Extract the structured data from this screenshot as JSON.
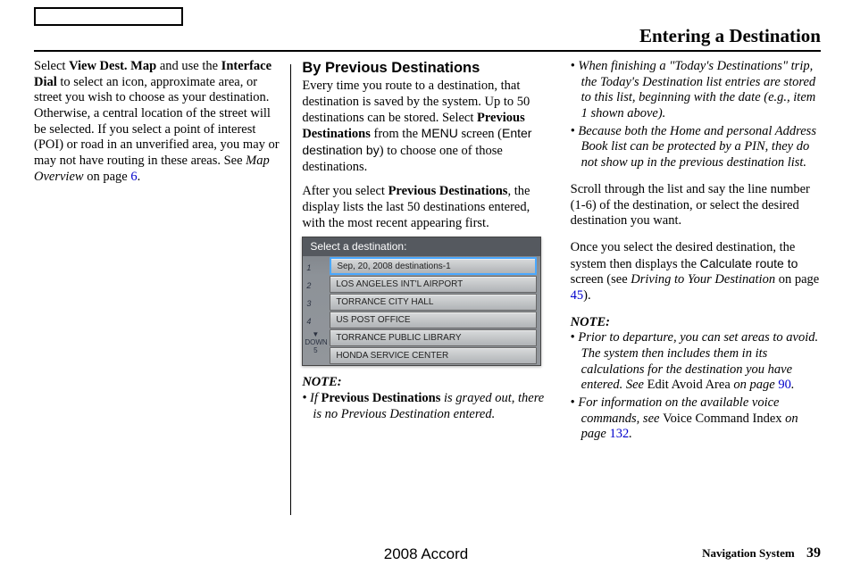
{
  "header": {
    "page_title": "Entering a Destination"
  },
  "col1": {
    "p1_a": "Select ",
    "p1_b": "View Dest. Map",
    "p1_c": " and use the ",
    "p1_d": "Interface Dial",
    "p1_e": " to select an icon, approximate area, or street you wish to choose as your destination. Otherwise, a central location of the street will be selected. If you select a point of interest (POI) or road in an unverified area, you may or may not have routing in these areas. See ",
    "p1_f": "Map Overview",
    "p1_g": " on page ",
    "p1_h": "6",
    "p1_i": "."
  },
  "col2": {
    "head": "By Previous Destinations",
    "p1_a": "Every time you route to a destination, that destination is saved by the system. Up to 50 destinations can be stored. Select ",
    "p1_b": "Previous Destinations",
    "p1_c": " from the ",
    "p1_d": "MENU",
    "p1_e": " screen (",
    "p1_f": "Enter destination by",
    "p1_g": ") to choose one of those destinations.",
    "p2_a": "After you select ",
    "p2_b": "Previous Destinations",
    "p2_c": ", the display lists the last 50 destinations entered, with the most recent appearing first.",
    "sc_header": "Select a destination:",
    "sc_items": {
      "r1": "Sep, 20, 2008 destinations-1",
      "r2": "LOS ANGELES INT'L AIRPORT",
      "r3": "TORRANCE CITY HALL",
      "r4": "US POST OFFICE",
      "r5": "TORRANCE PUBLIC LIBRARY",
      "r6": "HONDA SERVICE CENTER"
    },
    "note": "NOTE:",
    "note_li_a": "If ",
    "note_li_b": "Previous Destinations",
    "note_li_c": " is grayed out, there is no Previous Destination entered."
  },
  "col3": {
    "li1": "When finishing a \"Today's Destinations\" trip, the Today's Destination list entries are stored to this list, beginning with the date (e.g., item 1 shown above).",
    "li2": "Because both the Home and personal Address Book list can be protected by a PIN, they do not show up in the previous destination list.",
    "p1": "Scroll through the list and say the line number (1-6) of the destination, or select the desired destination you want.",
    "p2_a": "Once you select the desired destination, the system then displays the ",
    "p2_b": "Calculate route to",
    "p2_c": " screen (see ",
    "p2_d": "Driving to Your Destination",
    "p2_e": " on page ",
    "p2_f": "45",
    "p2_g": ").",
    "note": "NOTE:",
    "n1_a": "Prior to departure, you can set areas to avoid. The system then includes them in its calculations for the destination you have entered. See ",
    "n1_b": "Edit Avoid Area",
    "n1_c": " on page ",
    "n1_d": "90",
    "n1_e": ".",
    "n2_a": "For information on the available voice commands, see ",
    "n2_b": "Voice Command Index",
    "n2_c": " on page ",
    "n2_d": "132",
    "n2_e": "."
  },
  "footer": {
    "model": "2008  Accord",
    "label": "Navigation System",
    "page": "39"
  }
}
